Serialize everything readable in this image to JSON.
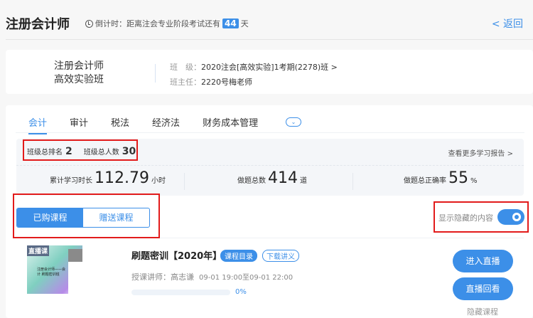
{
  "header": {
    "title": "注册会计师",
    "countdown_prefix": "倒计时：距离注会专业阶段考试还有",
    "countdown_days": "44",
    "countdown_suffix": "天",
    "back": "< 返回"
  },
  "info": {
    "name_line1": "注册会计师",
    "name_line2": "高效实验班",
    "class_label": "班　级：",
    "class_value": "2020注会[高效实验]1考期(2278)班 >",
    "teacher_label": "班主任：",
    "teacher_value": "2220号梅老师"
  },
  "tabs": [
    "会计",
    "审计",
    "税法",
    "经济法",
    "财务成本管理"
  ],
  "stats": {
    "rank_label": "班级总排名",
    "rank": "2",
    "total_label": "班级总人数",
    "total": "30",
    "report_link": "查看更多学习报告 >",
    "study_label": "累计学习时长",
    "study_value": "112.79",
    "study_unit": "小时",
    "questions_label": "做题总数",
    "questions_value": "414",
    "questions_unit": "道",
    "accuracy_label": "做题总正确率",
    "accuracy_value": "55",
    "accuracy_unit": "%"
  },
  "segment": {
    "purchased": "已购课程",
    "gifted": "赠送课程"
  },
  "show_hidden": {
    "label": "显示隐藏的内容",
    "on": true
  },
  "course": {
    "badge": "直播课",
    "thumb_text": "注册会计师——会计 刷题密训班",
    "title": "刷题密训【2020年】",
    "catalog": "课程目录",
    "download": "下载讲义",
    "teacher_label": "授课讲师：",
    "teacher": "高志谦",
    "time": "09-01 19:00至09-01 22:00",
    "progress": "0%",
    "enter": "进入直播",
    "replay": "直播回看",
    "hide": "隐藏课程"
  },
  "colors": {
    "accent": "#3c8fe8",
    "highlight": "#e21b1b"
  }
}
